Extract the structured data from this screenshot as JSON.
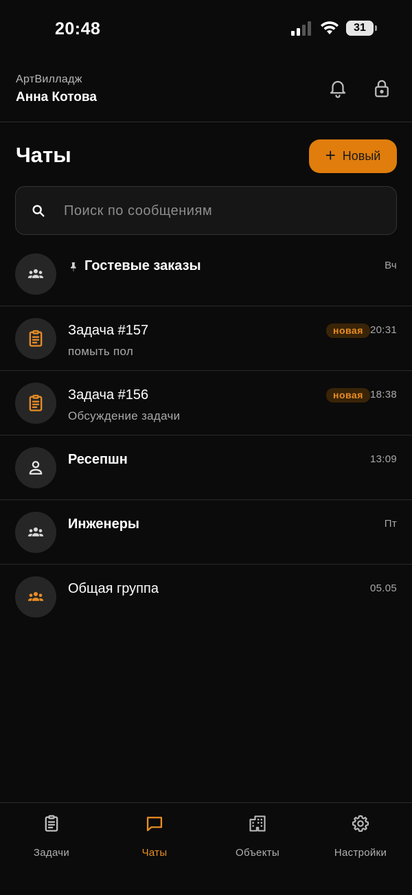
{
  "status_bar": {
    "time": "20:48",
    "battery": "31"
  },
  "header": {
    "company": "АртВилладж",
    "user": "Анна Котова"
  },
  "page": {
    "title": "Чаты",
    "new_button_label": "Новый",
    "new_button_plus": "+"
  },
  "search": {
    "placeholder": "Поиск по сообщениям"
  },
  "colors": {
    "accent": "#e07d0c",
    "background": "#0b0b0b",
    "badge_bg": "#3a2408"
  },
  "chats": [
    {
      "title": "Гостевые заказы",
      "subtitle": "",
      "time": "Вч",
      "badge": "",
      "icon": "group-icon",
      "pinned": true
    },
    {
      "title": "Задача #157",
      "subtitle": "помыть пол",
      "time": "20:31",
      "badge": "новая",
      "icon": "clipboard-icon",
      "pinned": false
    },
    {
      "title": "Задача #156",
      "subtitle": "Обсуждение задачи",
      "time": "18:38",
      "badge": "новая",
      "icon": "clipboard-icon",
      "pinned": false
    },
    {
      "title": "Ресепшн",
      "subtitle": "",
      "time": "13:09",
      "badge": "",
      "icon": "person-icon",
      "pinned": false
    },
    {
      "title": "Инженеры",
      "subtitle": "",
      "time": "Пт",
      "badge": "",
      "icon": "group-icon",
      "pinned": false
    },
    {
      "title": "Общая группа",
      "subtitle": "",
      "time": "05.05",
      "badge": "",
      "icon": "group-icon",
      "pinned": false
    }
  ],
  "nav": [
    {
      "label": "Задачи",
      "icon": "clipboard-icon",
      "active": false
    },
    {
      "label": "Чаты",
      "icon": "chat-icon",
      "active": true
    },
    {
      "label": "Объекты",
      "icon": "building-icon",
      "active": false
    },
    {
      "label": "Настройки",
      "icon": "gear-icon",
      "active": false
    }
  ]
}
